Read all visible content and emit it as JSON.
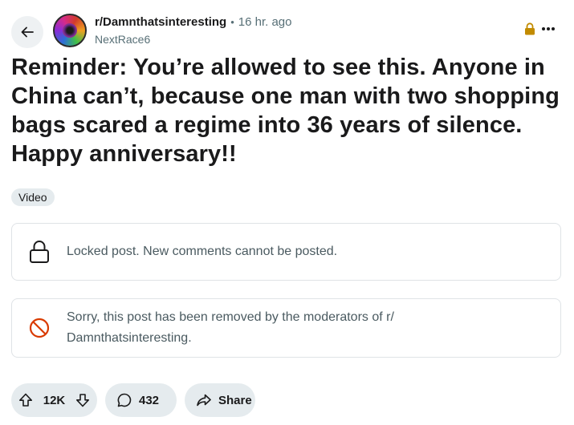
{
  "post": {
    "subreddit": "r/Damnthatsinteresting",
    "separator": "•",
    "time_ago": "16 hr. ago",
    "author": "NextRace6",
    "title": "Reminder: You’re allowed to see this. Anyone in China can’t, because one man with two shopping bags scared a regime into 36 years of silence. Happy anniversary!!",
    "flair": "Video"
  },
  "notices": {
    "locked": "Locked post. New comments cannot be posted.",
    "removed": "Sorry, this post has been removed by the moderators of r/ Damnthatsinteresting."
  },
  "actions": {
    "upvotes": "12K",
    "comments": "432",
    "share_label": "Share"
  },
  "icons": {
    "back": "arrow-left-icon",
    "lock": "lock-icon",
    "more": "more-icon",
    "removed": "prohibited-icon",
    "upvote": "upvote-icon",
    "downvote": "downvote-icon",
    "comment": "comment-icon",
    "share": "share-icon"
  },
  "colors": {
    "lock_accent": "#c28b00",
    "removed_red": "#d93a00",
    "pill_bg": "#e5ebee",
    "muted_text": "#576f76"
  }
}
